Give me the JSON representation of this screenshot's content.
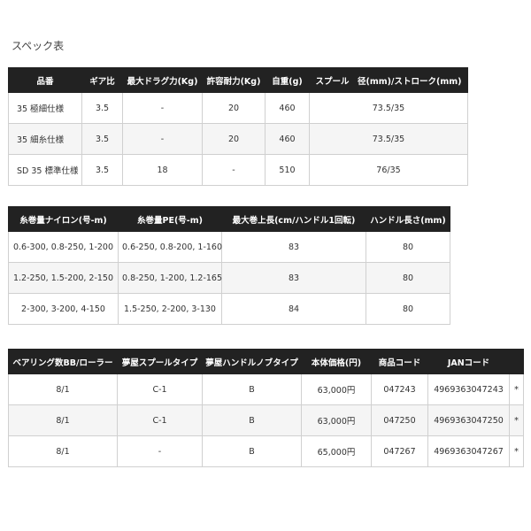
{
  "heading": "スペック表",
  "table1": {
    "headers": [
      "品番",
      "ギア比",
      "最大ドラグ力(Kg)",
      "許容耐力(Kg)",
      "自重(g)",
      "スプール　径(mm)/ストローク(mm)"
    ],
    "rows": [
      [
        "35 極細仕様",
        "3.5",
        "-",
        "20",
        "460",
        "73.5/35"
      ],
      [
        "35 細糸仕様",
        "3.5",
        "-",
        "20",
        "460",
        "73.5/35"
      ],
      [
        "SD 35 標準仕様",
        "3.5",
        "18",
        "-",
        "510",
        "76/35"
      ]
    ]
  },
  "table2": {
    "headers": [
      "糸巻量ナイロン(号-m)",
      "糸巻量PE(号-m)",
      "最大巻上長(cm/ハンドル1回転)",
      "ハンドル長さ(mm)"
    ],
    "rows": [
      [
        "0.6-300, 0.8-250, 1-200",
        "0.6-250, 0.8-200, 1-160",
        "83",
        "80"
      ],
      [
        "1.2-250, 1.5-200, 2-150",
        "0.8-250, 1-200, 1.2-165",
        "83",
        "80"
      ],
      [
        "2-300, 3-200, 4-150",
        "1.5-250, 2-200, 3-130",
        "84",
        "80"
      ]
    ]
  },
  "table3": {
    "headers": [
      "ベアリング数BB/ローラー",
      "夢屋スプールタイプ",
      "夢屋ハンドルノブタイプ",
      "本体価格(円)",
      "商品コード",
      "JANコード",
      ""
    ],
    "rows": [
      [
        "8/1",
        "C-1",
        "B",
        "63,000円",
        "047243",
        "4969363047243",
        "*"
      ],
      [
        "8/1",
        "C-1",
        "B",
        "63,000円",
        "047250",
        "4969363047250",
        "*"
      ],
      [
        "8/1",
        "-",
        "B",
        "65,000円",
        "047267",
        "4969363047267",
        "*"
      ]
    ]
  }
}
